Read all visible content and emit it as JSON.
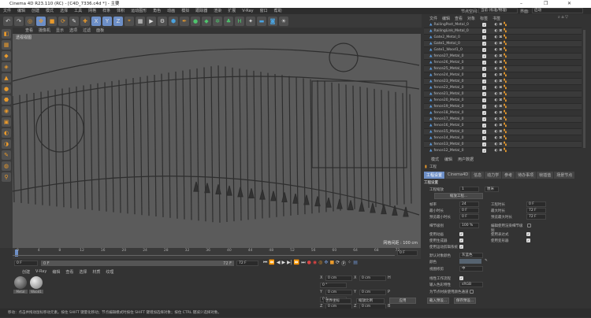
{
  "title": "Cinema 4D R23.110 (RC) - [C4D_7336.c4d *] - 主要",
  "window_controls": {
    "min": "–",
    "max": "❐",
    "close": "✕"
  },
  "menu": [
    "文件",
    "编辑",
    "创建",
    "模式",
    "选择",
    "工具",
    "网格",
    "样条",
    "体积",
    "运动图形",
    "角色",
    "动画",
    "模拟",
    "跟踪器",
    "渲染",
    "扩展",
    "V-Ray",
    "窗口",
    "帮助"
  ],
  "toolbar_icons": [
    "undo",
    "redo",
    "live-select",
    "move",
    "scale",
    "rotate",
    "recent",
    "move-axis",
    "x-axis",
    "y-axis",
    "z-axis",
    "coord-system",
    "render-view",
    "render",
    "render-settings",
    "cube",
    "pen",
    "subdivision",
    "extrude",
    "array",
    "cloner",
    "deformer",
    "field",
    "floor",
    "camera",
    "light"
  ],
  "top_right": {
    "node_space_label": "节点空间:",
    "node_space_value": "当前 (标准/物理)",
    "layout_label": "界面:",
    "layout_value": "启动"
  },
  "viewport": {
    "menu": [
      "查看",
      "摄像机",
      "显示",
      "选项",
      "过滤",
      "面板"
    ],
    "label": "透视视图",
    "grid": "网格间距 : 100 cm"
  },
  "timeline": {
    "ticks": [
      "0",
      "4",
      "8",
      "12",
      "16",
      "20",
      "24",
      "28",
      "32",
      "36",
      "40",
      "44",
      "48",
      "52",
      "56",
      "60",
      "64",
      "68",
      "72"
    ],
    "current": "0 F",
    "start": "0 F",
    "range_start": "0 F",
    "range_end": "72 F",
    "end": "72 F"
  },
  "materials": {
    "menu": [
      "创建",
      "V-Ray",
      "编辑",
      "查看",
      "选择",
      "材质",
      "纹理"
    ],
    "items": [
      "Metal",
      "Wood1"
    ]
  },
  "coords": {
    "rows": [
      [
        "X",
        "0 cm",
        "X",
        "0 cm",
        "H",
        "0 °"
      ],
      [
        "Y",
        "0 cm",
        "Y",
        "0 cm",
        "P",
        "0 °"
      ],
      [
        "Z",
        "0 cm",
        "Z",
        "0 cm",
        "B",
        "0 °"
      ]
    ],
    "mode": "世界坐标",
    "scale": "缩放比例",
    "apply": "应用"
  },
  "status": "移动：点击并拖动鼠标移动元素。按住 SHIFT 键量化移动；节点编辑模式时按住 SHIFT 键增加选择对象；按住 CTRL 键减少选择对象。",
  "object_manager": {
    "menu": [
      "文件",
      "编辑",
      "查看",
      "对象",
      "标签",
      "书签"
    ],
    "objects": [
      "RailingPost_Metal_0",
      "RailingLink_Metal_0",
      "Gate2_Metal_0",
      "Gate1_Metal_0",
      "Gate1_Wood1_0",
      "fence27_Metal_0",
      "fence26_Metal_0",
      "fence25_Metal_0",
      "fence24_Metal_0",
      "fence23_Metal_0",
      "fence22_Metal_0",
      "fence21_Metal_0",
      "fence20_Metal_0",
      "fence19_Metal_0",
      "fence18_Metal_0",
      "fence17_Metal_0",
      "fence16_Metal_0",
      "fence15_Metal_0",
      "fence14_Metal_0",
      "fence13_Metal_0",
      "fence12_Metal_0"
    ]
  },
  "attributes": {
    "menu": [
      "模式",
      "编辑",
      "用户数据"
    ],
    "object": "工程",
    "tabs": [
      "工程设置",
      "Cinema4D",
      "信息",
      "动力学",
      "参考",
      "待办事项",
      "帧插值",
      "场景节点"
    ],
    "section": "工程设置",
    "scale_label": "工程缩放",
    "scale_value": "1",
    "scale_unit": "厘米",
    "scale_btn": "缩放工程...",
    "fps_label": "帧率",
    "fps": "24",
    "proj_time_label": "工程时长",
    "proj_time": "0 F",
    "min_label": "最小时长",
    "min": "0 F",
    "max_label": "最大时长",
    "max": "72 F",
    "pmin_label": "预览最小时长",
    "pmin": "0 F",
    "pmax_label": "预览最大时长",
    "pmax": "72 F",
    "lod_label": "细节级别",
    "lod": "100 %",
    "render_lod_label": "编辑使用渲染细节级别",
    "use_anim": "使用动画",
    "use_expr": "使用表达式",
    "use_gen": "使用生成器",
    "use_deform": "使用变形器",
    "use_motion": "使用运动剪辑系统",
    "def_color_label": "默认对象颜色",
    "def_color": "灰蓝色",
    "color_label": "颜色",
    "clip_label": "视图修剪",
    "clip": "中",
    "lwf_label": "线性工作流程",
    "input_label": "输入色彩特性",
    "input": "sRGB",
    "node_label": "为节点材质使用颜色通道",
    "load": "载入预设...",
    "save": "保存预设..."
  }
}
